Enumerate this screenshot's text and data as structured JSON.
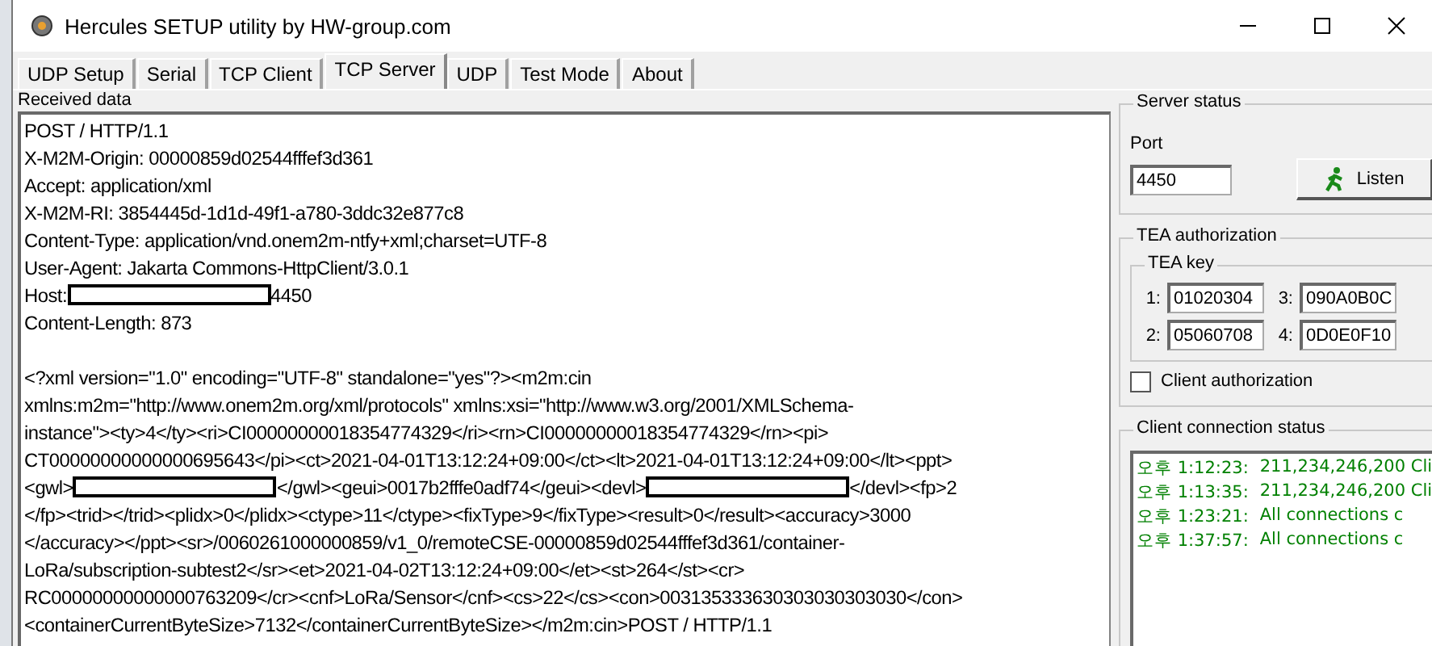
{
  "window": {
    "title": "Hercules SETUP utility by HW-group.com"
  },
  "tabs": [
    {
      "label": "UDP Setup",
      "selected": false
    },
    {
      "label": "Serial",
      "selected": false
    },
    {
      "label": "TCP Client",
      "selected": false
    },
    {
      "label": "TCP Server",
      "selected": true
    },
    {
      "label": "UDP",
      "selected": false
    },
    {
      "label": "Test Mode",
      "selected": false
    },
    {
      "label": "About",
      "selected": false
    }
  ],
  "received_data": {
    "label": "Received data",
    "lines": [
      {
        "kind": "text",
        "parts": [
          {
            "kind": "text",
            "text": "POST / HTTP/1.1"
          }
        ]
      },
      {
        "kind": "text",
        "parts": [
          {
            "kind": "text",
            "text": "X-M2M-Origin: 00000859d02544fffef3d361"
          }
        ]
      },
      {
        "kind": "text",
        "parts": [
          {
            "kind": "text",
            "text": "Accept: application/xml"
          }
        ]
      },
      {
        "kind": "text",
        "parts": [
          {
            "kind": "text",
            "text": "X-M2M-RI: 3854445d-1d1d-49f1-a780-3ddc32e877c8"
          }
        ]
      },
      {
        "kind": "text",
        "parts": [
          {
            "kind": "text",
            "text": "Content-Type: application/vnd.onem2m-ntfy+xml;charset=UTF-8"
          }
        ]
      },
      {
        "kind": "text",
        "parts": [
          {
            "kind": "text",
            "text": "User-Agent: Jakarta Commons-HttpClient/3.0.1"
          }
        ]
      },
      {
        "kind": "text",
        "parts": [
          {
            "kind": "text",
            "text": "Host:"
          },
          {
            "kind": "redacted"
          },
          {
            "kind": "text",
            "text": "4450"
          }
        ]
      },
      {
        "kind": "text",
        "parts": [
          {
            "kind": "text",
            "text": "Content-Length: 873"
          }
        ]
      },
      {
        "kind": "blank"
      },
      {
        "kind": "text",
        "parts": [
          {
            "kind": "text",
            "text": "<?xml version=\"1.0\" encoding=\"UTF-8\" standalone=\"yes\"?><m2m:cin"
          }
        ]
      },
      {
        "kind": "text",
        "parts": [
          {
            "kind": "text",
            "text": "xmlns:m2m=\"http://www.onem2m.org/xml/protocols\" xmlns:xsi=\"http://www.w3.org/2001/XMLSchema-"
          }
        ]
      },
      {
        "kind": "text",
        "parts": [
          {
            "kind": "text",
            "text": "instance\"><ty>4</ty><ri>CI00000000018354774329</ri><rn>CI00000000018354774329</rn><pi>"
          }
        ]
      },
      {
        "kind": "text",
        "parts": [
          {
            "kind": "text",
            "text": "CT00000000000000695643</pi><ct>2021-04-01T13:12:24+09:00</ct><lt>2021-04-01T13:12:24+09:00</lt><ppt>"
          }
        ]
      },
      {
        "kind": "text",
        "parts": [
          {
            "kind": "text",
            "text": "<gwl>"
          },
          {
            "kind": "redacted"
          },
          {
            "kind": "text",
            "text": "</gwl><geui>0017b2fffe0adf74</geui><devl>"
          },
          {
            "kind": "redacted"
          },
          {
            "kind": "text",
            "text": "</devl><fp>2"
          }
        ]
      },
      {
        "kind": "text",
        "parts": [
          {
            "kind": "text",
            "text": "</fp><trid></trid><plidx>0</plidx><ctype>11</ctype><fixType>9</fixType><result>0</result><accuracy>3000"
          }
        ]
      },
      {
        "kind": "text",
        "parts": [
          {
            "kind": "text",
            "text": "</accuracy></ppt><sr>/0060261000000859/v1_0/remoteCSE-00000859d02544fffef3d361/container-"
          }
        ]
      },
      {
        "kind": "text",
        "parts": [
          {
            "kind": "text",
            "text": "LoRa/subscription-subtest2</sr><et>2021-04-02T13:12:24+09:00</et><st>264</st><cr>"
          }
        ]
      },
      {
        "kind": "text",
        "parts": [
          {
            "kind": "text",
            "text": "RC00000000000000763209</cr><cnf>LoRa/Sensor</cnf><cs>22</cs><con>003135333630303030303030</con>"
          }
        ]
      },
      {
        "kind": "text",
        "parts": [
          {
            "kind": "text",
            "text": "<containerCurrentByteSize>7132</containerCurrentByteSize></m2m:cin>POST / HTTP/1.1"
          }
        ]
      }
    ]
  },
  "server_status": {
    "title": "Server status",
    "port_label": "Port",
    "port": "4450",
    "listen_button": "Listen"
  },
  "tea_authorization": {
    "title": "TEA authorization",
    "key_title": "TEA key",
    "keys": [
      {
        "label": "1:",
        "value": "01020304"
      },
      {
        "label": "3:",
        "value": "090A0B0C"
      },
      {
        "label": "2:",
        "value": "05060708"
      },
      {
        "label": "4:",
        "value": "0D0E0F10"
      }
    ],
    "client_authorization": {
      "label": "Client authorization",
      "checked": false
    }
  },
  "client_connection_status": {
    "title": "Client connection status",
    "entries": [
      {
        "time": "오후 1:12:23:",
        "message": "211,234,246,200 Cli"
      },
      {
        "time": "오후 1:13:35:",
        "message": "211,234,246,200 Cli"
      },
      {
        "time": "오후 1:23:21:",
        "message": "All connections c"
      },
      {
        "time": "오후 1:37:57:",
        "message": "All connections c"
      }
    ]
  }
}
